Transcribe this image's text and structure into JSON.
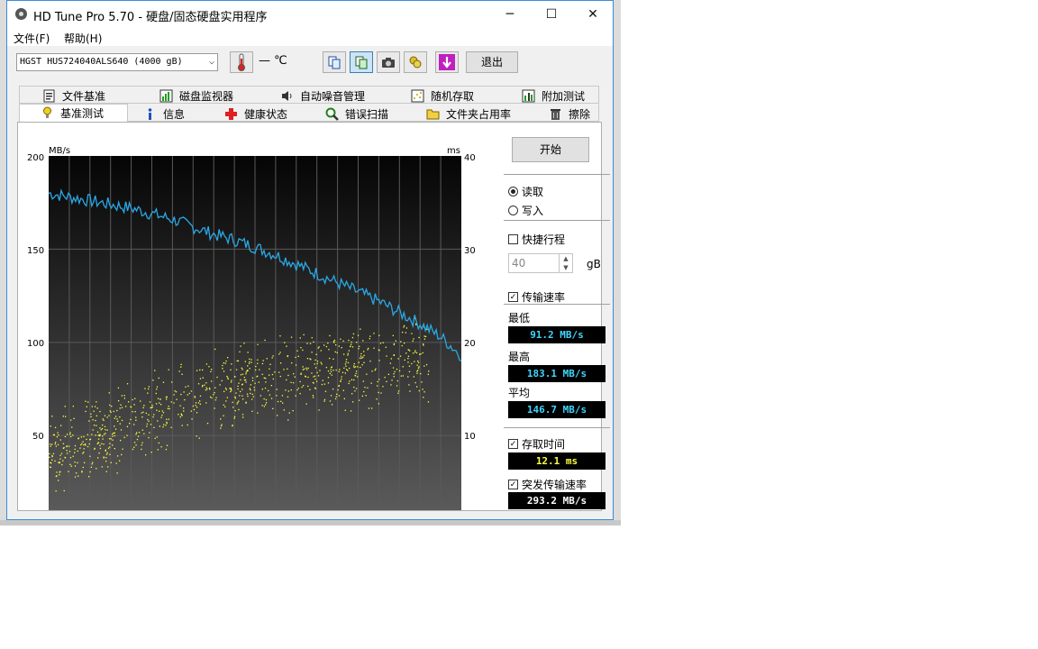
{
  "window": {
    "title": "HD Tune Pro 5.70 - 硬盘/固态硬盘实用程序",
    "minimize": "─",
    "maximize": "☐",
    "close": "✕"
  },
  "menu": [
    {
      "label": "文件(F)"
    },
    {
      "label": "帮助(H)"
    }
  ],
  "toolbar": {
    "drive": "HGST   HUS724040ALS640 (4000 gB)",
    "temperature": "— ℃",
    "exit_label": "退出",
    "icons": [
      "copy-icon",
      "copy-info-icon",
      "camera-icon",
      "drives-icon",
      "save-icon"
    ]
  },
  "tabs_row1": [
    {
      "label": "文件基准",
      "icon": "file-benchmark-icon"
    },
    {
      "label": "磁盘监视器",
      "icon": "disk-monitor-icon"
    },
    {
      "label": "自动噪音管理",
      "icon": "speaker-icon"
    },
    {
      "label": "随机存取",
      "icon": "random-access-icon"
    },
    {
      "label": "附加测试",
      "icon": "extra-tests-icon"
    }
  ],
  "tabs_row2": [
    {
      "label": "基准测试",
      "icon": "benchmark-icon",
      "active": true
    },
    {
      "label": "信息",
      "icon": "info-icon"
    },
    {
      "label": "健康状态",
      "icon": "health-icon"
    },
    {
      "label": "错误扫描",
      "icon": "error-scan-icon"
    },
    {
      "label": "文件夹占用率",
      "icon": "folder-icon"
    },
    {
      "label": "擦除",
      "icon": "erase-icon"
    }
  ],
  "side": {
    "start_label": "开始",
    "read_label": "读取",
    "write_label": "写入",
    "mode": "read",
    "short_stroke_label": "快捷行程",
    "short_stroke_checked": false,
    "short_stroke_value": "40",
    "short_stroke_unit": "gB",
    "transfer_rate_label": "传输速率",
    "transfer_rate_checked": true,
    "min_label": "最低",
    "min_value": "91.2 MB/s",
    "max_label": "最高",
    "max_value": "183.1 MB/s",
    "avg_label": "平均",
    "avg_value": "146.7 MB/s",
    "access_time_label": "存取时间",
    "access_time_checked": true,
    "access_time_value": "12.1 ms",
    "burst_label": "突发传输速率",
    "burst_checked": true,
    "burst_value": "293.2 MB/s"
  },
  "chart_data": {
    "type": "line",
    "left_unit": "MB/s",
    "right_unit": "ms",
    "left_ticks": [
      "200",
      "150",
      "100",
      "50"
    ],
    "right_ticks": [
      "40",
      "30",
      "20",
      "10"
    ],
    "ylim_left": [
      0,
      200
    ],
    "ylim_right": [
      0,
      40
    ],
    "xlim": [
      0,
      100
    ],
    "grid": true,
    "series": [
      {
        "color": "#2aa8e6",
        "axis": "left",
        "x": [
          0,
          5,
          10,
          15,
          20,
          25,
          30,
          35,
          40,
          45,
          50,
          55,
          60,
          65,
          70,
          75,
          80,
          85,
          90,
          95,
          100
        ],
        "values": [
          180,
          178,
          176,
          174,
          172,
          169,
          166,
          162,
          158,
          155,
          151,
          147,
          142,
          137,
          132,
          127,
          122,
          116,
          110,
          103,
          93
        ]
      },
      {
        "color": "#ffff40",
        "axis": "right",
        "kind": "scatter",
        "x_range": [
          0,
          100
        ],
        "trend": [
          [
            0,
            8
          ],
          [
            25,
            12.5
          ],
          [
            50,
            16
          ],
          [
            75,
            17.5
          ],
          [
            92,
            18.5
          ]
        ],
        "spread": 5,
        "count": 900
      }
    ]
  }
}
